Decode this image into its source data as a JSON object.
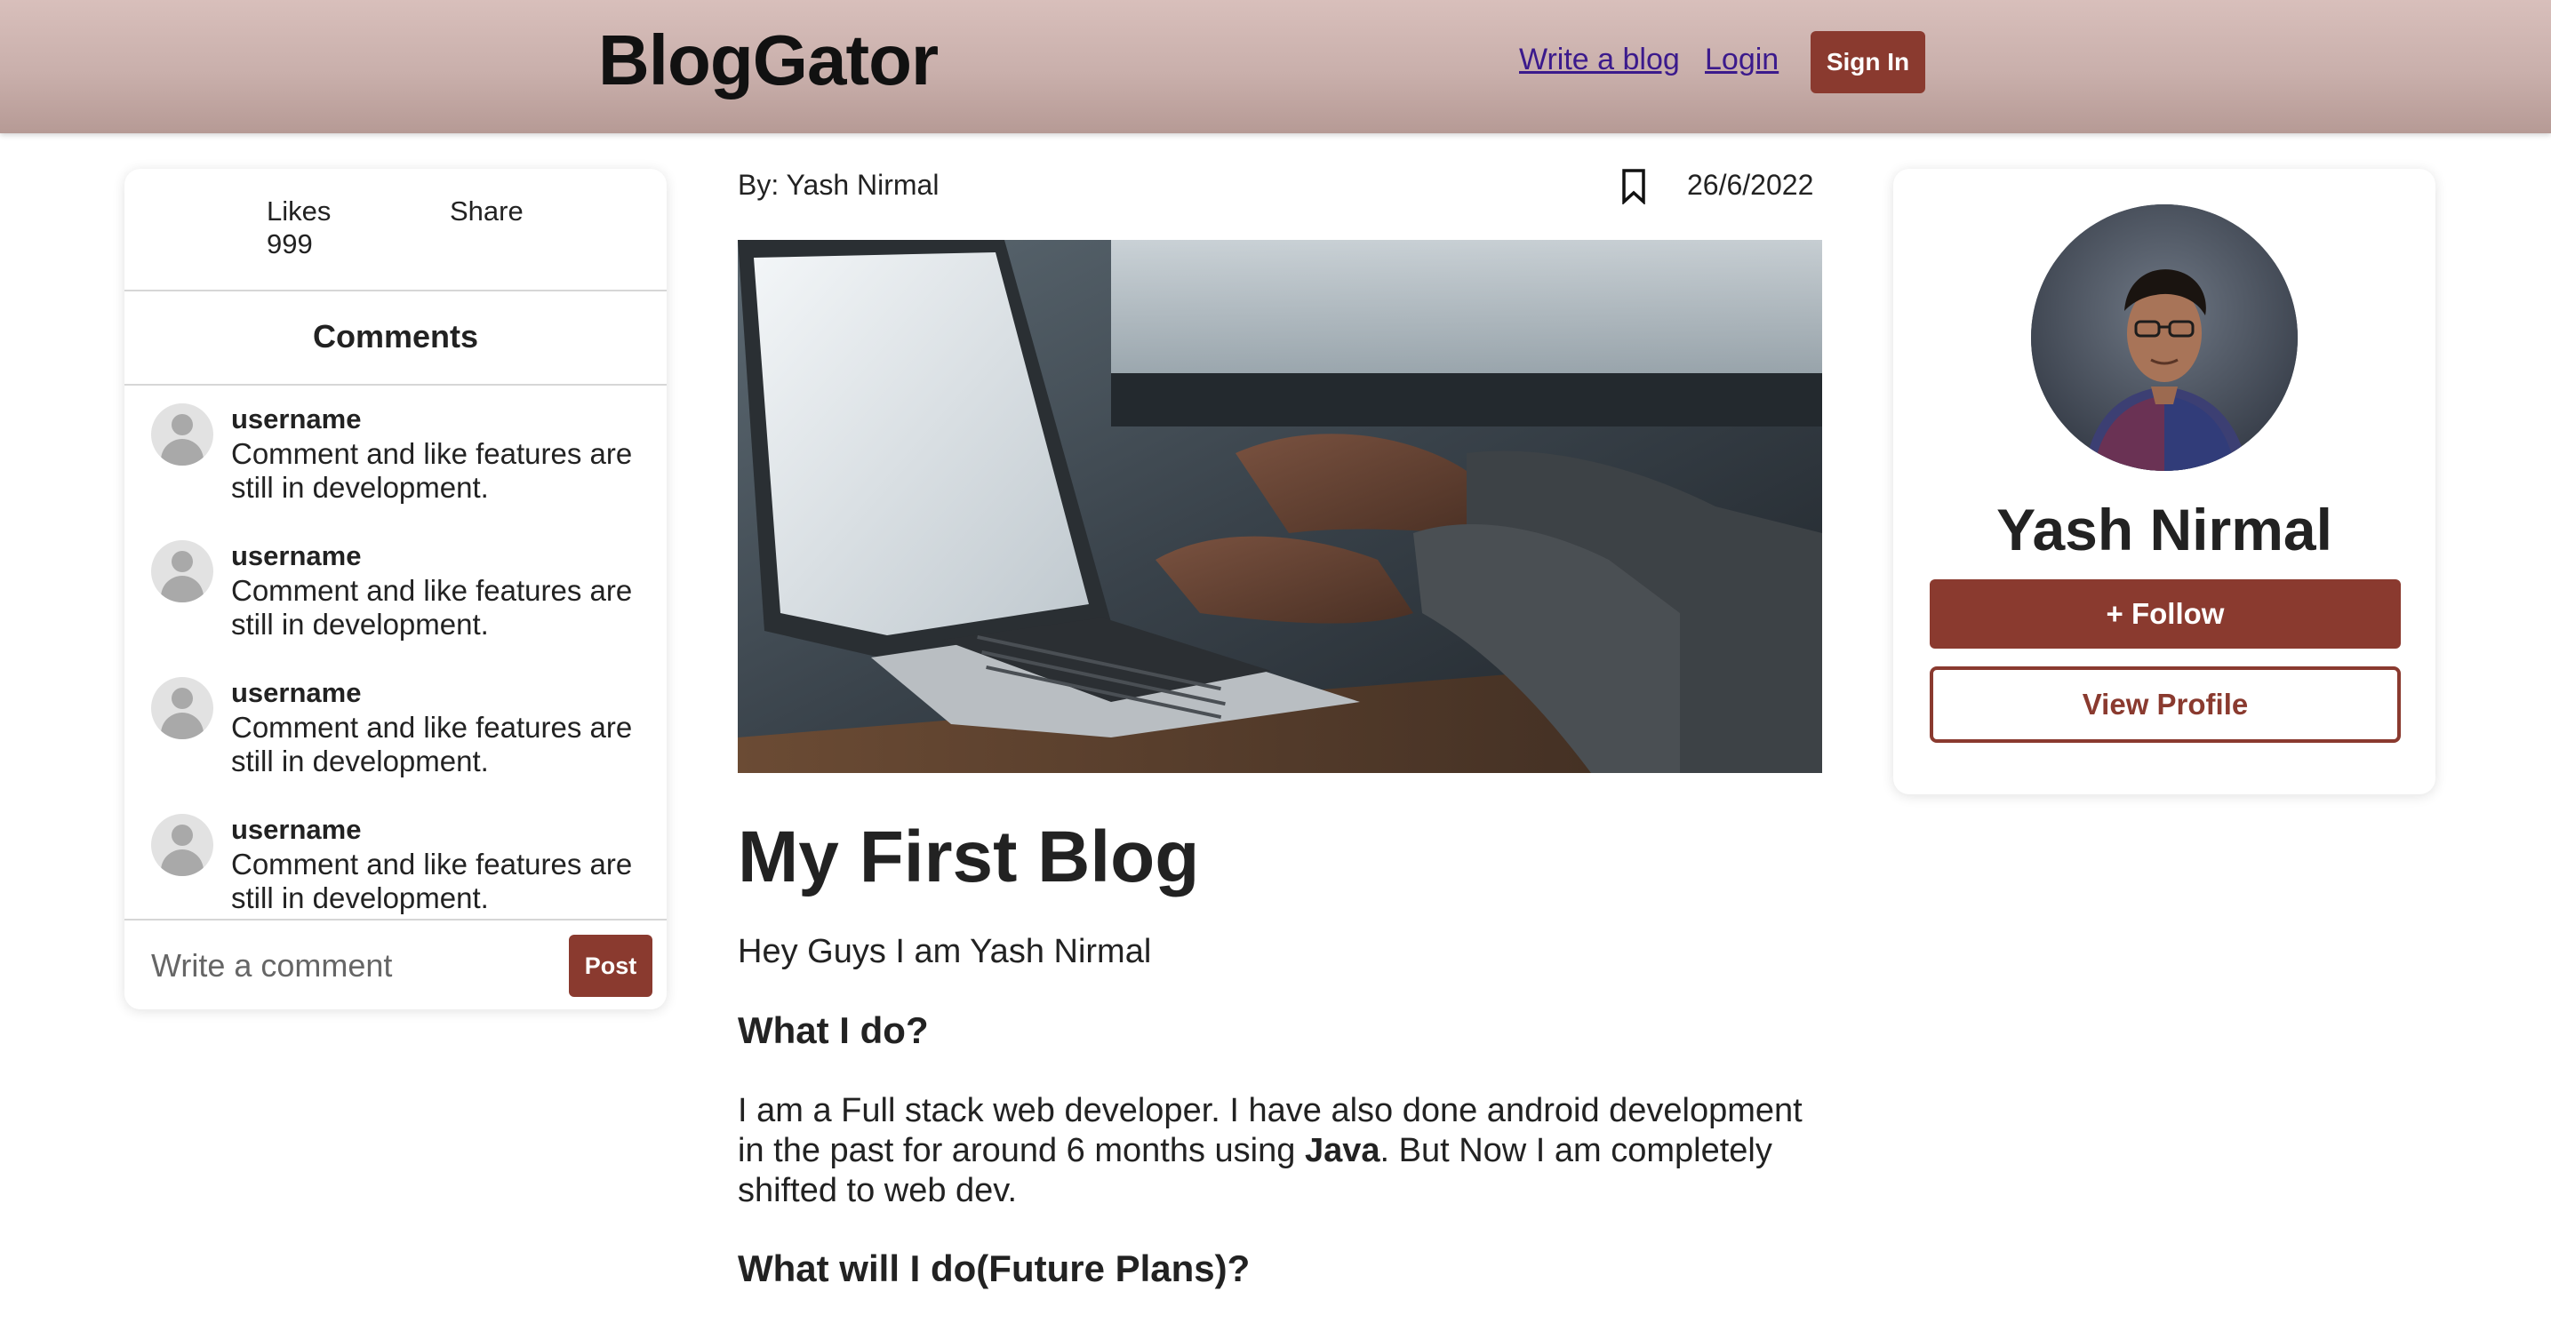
{
  "header": {
    "brand": "BlogGator",
    "nav": {
      "write_blog": "Write a blog",
      "login": "Login",
      "sign_in": "Sign In"
    }
  },
  "left_panel": {
    "likes_label": "Likes",
    "likes_value": "999",
    "share_label": "Share",
    "comments_title": "Comments",
    "comments": [
      {
        "username": "username",
        "text": "Comment and like features are still in development."
      },
      {
        "username": "username",
        "text": "Comment and like features are still in development."
      },
      {
        "username": "username",
        "text": "Comment and like features are still in development."
      },
      {
        "username": "username",
        "text": "Comment and like features are still in development."
      }
    ],
    "comment_placeholder": "Write a comment",
    "post_label": "Post"
  },
  "article": {
    "byline": "By: Yash Nirmal",
    "date": "26/6/2022",
    "title": "My First Blog",
    "intro": "Hey Guys I am Yash Nirmal",
    "section1_heading": "What I do?",
    "section1_text_before": "I am a Full stack web developer. I have also done android development in the past for around 6 months using ",
    "section1_bold": "Java",
    "section1_text_after": ". But Now I am completely shifted to web dev.",
    "section2_heading": "What will I do(Future Plans)?"
  },
  "profile": {
    "name": "Yash Nirmal",
    "follow_label": "+ Follow",
    "view_profile_label": "View Profile"
  },
  "icons": {
    "bookmark": "bookmark-icon",
    "comment_avatar": "user-avatar-icon"
  },
  "colors": {
    "accent": "#8a3a2f",
    "header_bg": "#c9afab",
    "link": "#3b1a8c"
  }
}
